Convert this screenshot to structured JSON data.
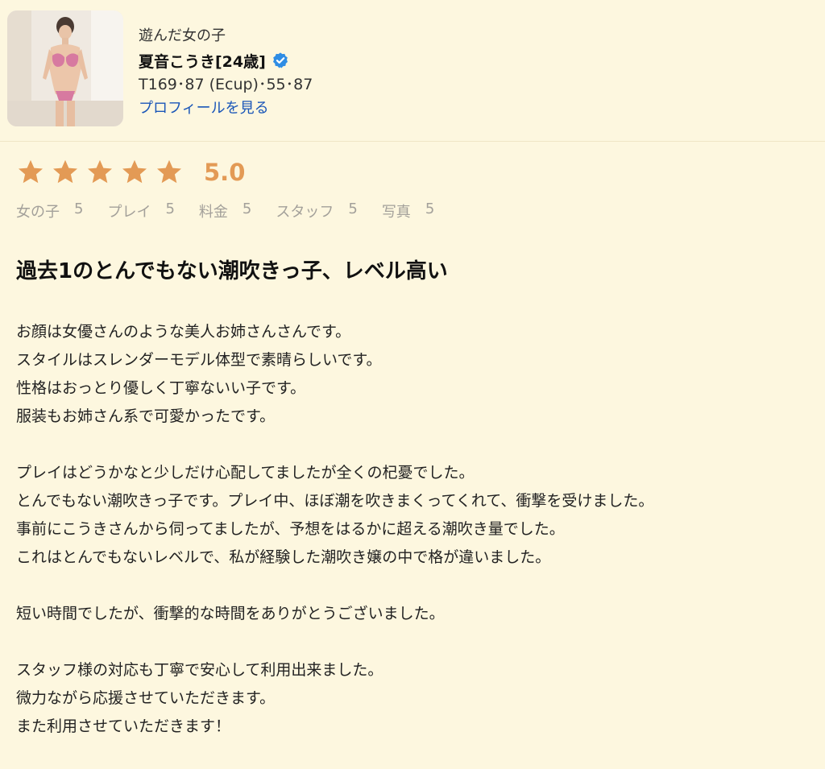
{
  "profile": {
    "caption": "遊んだ女の子",
    "name": "夏音こうき[24歳]",
    "verified_icon": "verified-check-icon",
    "measurements": "T169･87 (Ecup)･55･87",
    "link_label": "プロフィールを見る"
  },
  "rating": {
    "stars": 5,
    "max_stars": 5,
    "score": "5.0",
    "star_color": "#e39a55",
    "categories": [
      {
        "label": "女の子",
        "value": "5"
      },
      {
        "label": "プレイ",
        "value": "5"
      },
      {
        "label": "料金",
        "value": "5"
      },
      {
        "label": "スタッフ",
        "value": "5"
      },
      {
        "label": "写真",
        "value": "5"
      }
    ]
  },
  "review": {
    "title": "過去1のとんでもない潮吹きっ子、レベル高い",
    "paragraphs": [
      [
        "お顔は女優さんのような美人お姉さんさんです。",
        "スタイルはスレンダーモデル体型で素晴らしいです。",
        "性格はおっとり優しく丁寧ないい子です。",
        "服装もお姉さん系で可愛かったです。"
      ],
      [
        "プレイはどうかなと少しだけ心配してましたが全くの杞憂でした。",
        "とんでもない潮吹きっ子です。プレイ中、ほぼ潮を吹きまくってくれて、衝撃を受けました。",
        "事前にこうきさんから伺ってましたが、予想をはるかに超える潮吹き量でした。",
        "これはとんでもないレベルで、私が経験した潮吹き嬢の中で格が違いました。"
      ],
      [
        "短い時間でしたが、衝撃的な時間をありがとうございました。"
      ],
      [
        "スタッフ様の対応も丁寧で安心して利用出来ました。",
        "微力ながら応援させていただきます。",
        "また利用させていただきます！"
      ]
    ]
  },
  "colors": {
    "background": "#fdf7df",
    "link": "#1a56b8",
    "verified": "#2f8de4",
    "muted_text": "#a3a09a"
  }
}
